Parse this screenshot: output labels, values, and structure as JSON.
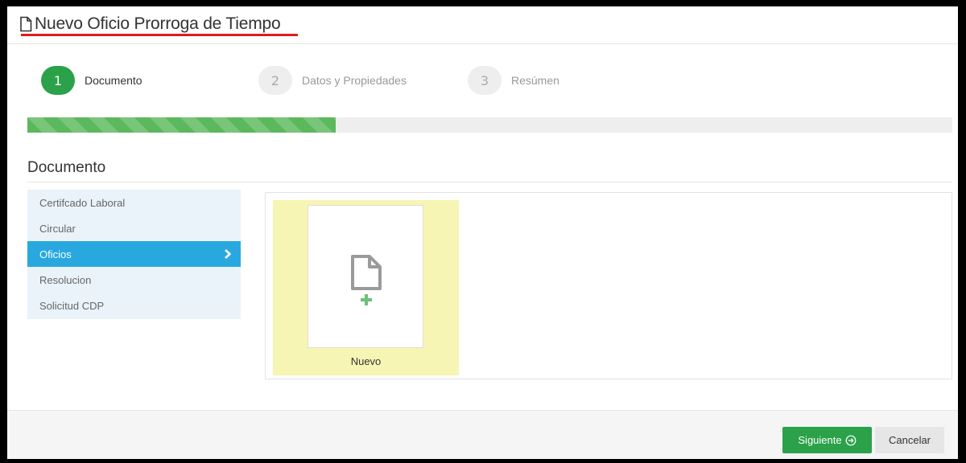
{
  "header": {
    "title": "Nuevo Oficio Prorroga de Tiempo",
    "title_icon": "document-icon"
  },
  "wizard": {
    "progress_percent": 33.3,
    "steps": [
      {
        "number": "1",
        "label": "Documento",
        "state": "active"
      },
      {
        "number": "2",
        "label": "Datos y Propiedades",
        "state": "inactive"
      },
      {
        "number": "3",
        "label": "Resúmen",
        "state": "inactive"
      }
    ]
  },
  "section": {
    "title": "Documento"
  },
  "categories": [
    {
      "label": "Certifcado Laboral"
    },
    {
      "label": "Circular"
    },
    {
      "label": "Oficios",
      "selected": true,
      "icon": "chevron-right-icon"
    },
    {
      "label": "Resolucion"
    },
    {
      "label": "Solicitud CDP"
    }
  ],
  "templates": [
    {
      "label": "Nuevo",
      "icon": "new-document-icon"
    }
  ],
  "footer": {
    "next_label": "Siguiente",
    "next_icon": "arrow-circle-right-icon",
    "cancel_label": "Cancelar"
  },
  "colors": {
    "accent_green": "#2ba14a",
    "selected_blue": "#29a8df",
    "template_highlight": "#f7f5b3",
    "title_underline": "#e21b1b"
  }
}
